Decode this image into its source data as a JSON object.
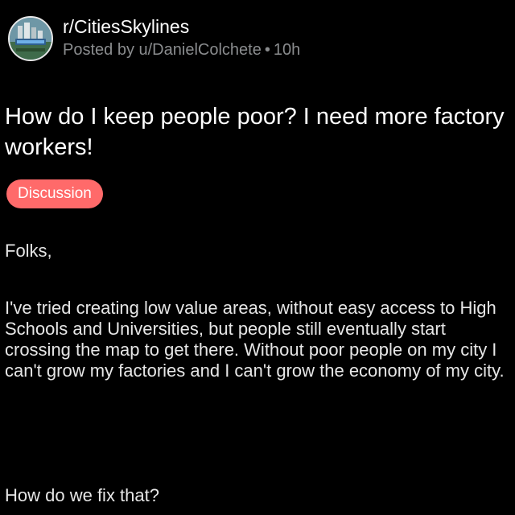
{
  "post": {
    "subreddit": "r/CitiesSkylines",
    "author": "Posted by u/DanielColchete",
    "separator": "•",
    "age": "10h",
    "title": "How do I keep people poor? I need more factory workers!",
    "flair": "Discussion",
    "flair_color": "#ff6a6a",
    "body": {
      "greeting": "Folks,",
      "paragraph": "I've tried creating low value areas, without easy access to High Schools and Universities, but people still eventually start crossing the map to get there. Without poor people on my city I can't grow my factories and I can't grow the economy of my city.",
      "question": "How do we fix that?"
    }
  },
  "colors": {
    "background": "#000000",
    "title_text": "#ffffff",
    "meta_text": "#8a8c8e",
    "body_text": "#e6e6e6"
  },
  "icons": {
    "subreddit_avatar": "cities-skylines-logo-icon"
  }
}
